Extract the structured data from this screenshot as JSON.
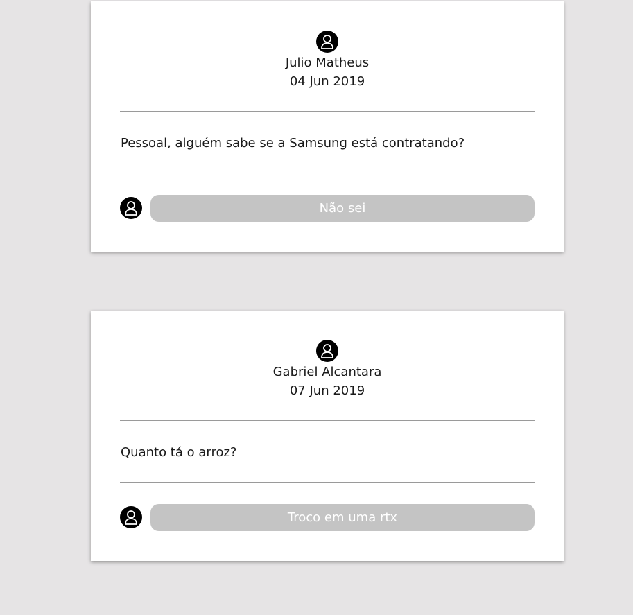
{
  "posts": [
    {
      "author": "Julio Matheus",
      "date": "04 Jun 2019",
      "body": "Pessoal, alguém sabe se a Samsung está contratando?",
      "reply_text": "Não sei",
      "avatar_icon": "user-icon"
    },
    {
      "author": "Gabriel Alcantara",
      "date": "07 Jun 2019",
      "body": "Quanto tá o arroz?",
      "reply_text": "Troco em uma rtx",
      "avatar_icon": "user-icon"
    }
  ],
  "colors": {
    "page_background": "#e6e4e5",
    "card_background": "#ffffff",
    "reply_background": "#c4c4c4",
    "avatar_background": "#000000",
    "divider": "#9a9a9a"
  }
}
